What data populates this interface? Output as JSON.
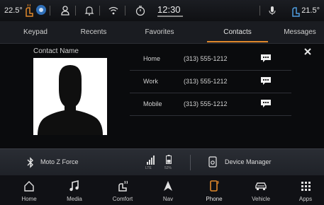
{
  "status_bar": {
    "temp_left": "22.5°",
    "clock": "12:30",
    "temp_right": "21.5°",
    "icons": [
      "seat-heat-icon",
      "fan-icon",
      "person-icon",
      "bell-icon",
      "wifi-icon",
      "timer-icon",
      "mic-icon",
      "seat-heat-icon"
    ]
  },
  "tabs": [
    {
      "label": "Keypad"
    },
    {
      "label": "Recents"
    },
    {
      "label": "Favorites"
    },
    {
      "label": "Contacts",
      "active": true
    },
    {
      "label": "Messages"
    }
  ],
  "contact": {
    "name_label": "Contact Name",
    "numbers": [
      {
        "type": "Home",
        "number": "(313) 555-1212"
      },
      {
        "type": "Work",
        "number": "(313) 555-1212"
      },
      {
        "type": "Mobile",
        "number": "(313) 555-1212"
      }
    ]
  },
  "device_bar": {
    "device_name": "Moto Z Force",
    "signal_label": "LTE",
    "battery_label": "52%",
    "manager_label": "Device Manager"
  },
  "nav": [
    {
      "label": "Home",
      "icon": "home-icon"
    },
    {
      "label": "Media",
      "icon": "music-icon"
    },
    {
      "label": "Comfort",
      "icon": "comfort-icon"
    },
    {
      "label": "Nav",
      "icon": "nav-arrow-icon"
    },
    {
      "label": "Phone",
      "icon": "phone-icon",
      "active": true
    },
    {
      "label": "Vehicle",
      "icon": "car-icon"
    },
    {
      "label": "Apps",
      "icon": "apps-icon"
    }
  ],
  "colors": {
    "accent": "#e0882b",
    "background": "#0a0b0d",
    "bar": "#1a1c21"
  }
}
